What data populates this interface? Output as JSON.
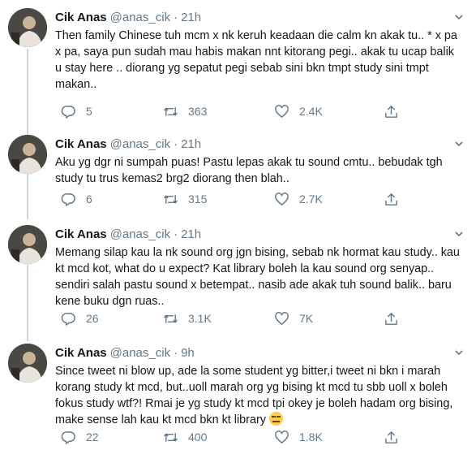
{
  "colors": {
    "text": "#14171a",
    "muted": "#657786",
    "divider": "#e6ecf0",
    "thread": "#ccd6dd"
  },
  "tweets": [
    {
      "name": "Cik Anas",
      "handle": "@anas_cik",
      "dot": "·",
      "time": "21h",
      "text": "Then family Chinese tuh mcm x nk keruh keadaan die calm kn akak tu.. * x pa x pa, saya pun sudah mau habis makan nnt kitorang pegi.. akak tu ucap balik u stay here .. diorang yg sepatut pegi sebab sini bkn tmpt study sini tmpt makan..",
      "replies": "5",
      "retweets": "363",
      "likes": "2.4K"
    },
    {
      "name": "Cik Anas",
      "handle": "@anas_cik",
      "dot": "·",
      "time": "21h",
      "text": "Aku yg dgr ni sumpah puas! Pastu lepas akak tu sound cmtu.. bebudak tgh study tu trus kemas2 brg2 diorang then blah..",
      "replies": "6",
      "retweets": "315",
      "likes": "2.7K"
    },
    {
      "name": "Cik Anas",
      "handle": "@anas_cik",
      "dot": "·",
      "time": "21h",
      "text": "Memang silap kau la nk sound org jgn bising, sebab nk hormat kau study.. kau kt mcd kot, what do u expect? Kat library boleh la kau sound org senyap.. sendiri salah pastu sound x betempat.. nasib ade akak tuh sound balik.. baru kene buku dgn ruas..",
      "replies": "26",
      "retweets": "3.1K",
      "likes": "7K"
    },
    {
      "name": "Cik Anas",
      "handle": "@anas_cik",
      "dot": "·",
      "time": "9h",
      "text": "Since tweet ni blow up, ade la some student yg bitter,i tweet ni bkn i marah korang study kt mcd, but..uoll marah org yg bising kt mcd tu sbb uoll x boleh fokus study wtf?! Rmai je yg study kt mcd tpi okey je boleh hadam org bising, make sense lah kau kt mcd bkn kt library",
      "emoji": "expressionless-face-emoji",
      "replies": "22",
      "retweets": "400",
      "likes": "1.8K"
    }
  ],
  "icons": {
    "reply": "reply-icon",
    "retweet": "retweet-icon",
    "like": "like-icon",
    "share": "share-icon",
    "caret": "chevron-down-icon"
  }
}
